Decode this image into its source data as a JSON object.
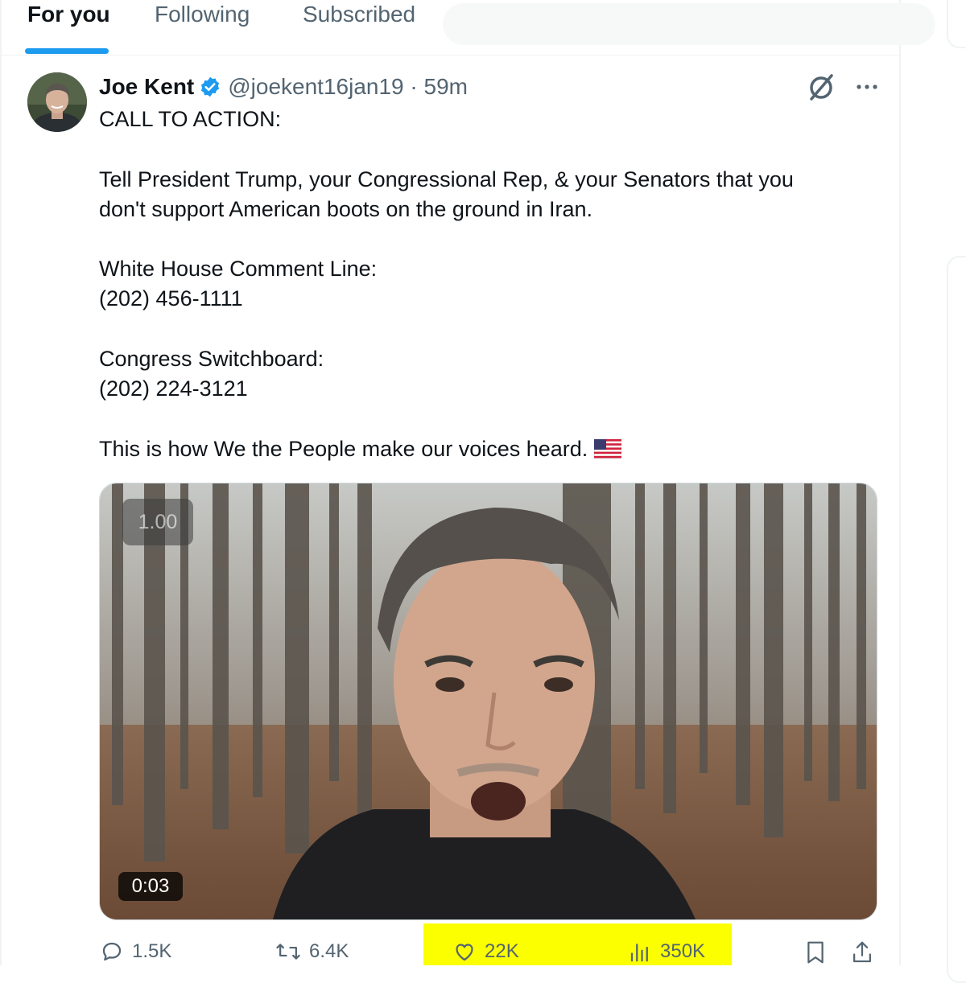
{
  "tabs": [
    {
      "label": "For you",
      "active": true
    },
    {
      "label": "Following",
      "active": false
    },
    {
      "label": "Subscribed",
      "active": false
    }
  ],
  "tweet": {
    "author_name": "Joe Kent",
    "handle_time": "@joekent16jan19 · 59m",
    "verified": true,
    "lines": [
      "CALL TO ACTION:",
      "Tell President Trump, your Congressional Rep, & your Senators that you",
      "don't support American boots on the ground in Iran.",
      "White House Comment Line:",
      "(202) 456-1111",
      "Congress Switchboard:",
      "(202) 224-3121",
      "This is how We the People make our voices heard."
    ],
    "video": {
      "playback_speed": "1.00",
      "timestamp": "0:03"
    },
    "actions": {
      "replies": "1.5K",
      "reposts": "6.4K",
      "likes": "22K",
      "views": "350K"
    }
  },
  "colors": {
    "accent": "#1d9bf0",
    "highlight": "#fcff00",
    "secondary_text": "#536471",
    "primary_text": "#0f1419"
  },
  "icons": [
    "verified-badge-icon",
    "grok-icon",
    "more-icon",
    "us-flag-icon",
    "reply-icon",
    "repost-icon",
    "like-icon",
    "views-icon",
    "bookmark-icon",
    "share-icon"
  ]
}
